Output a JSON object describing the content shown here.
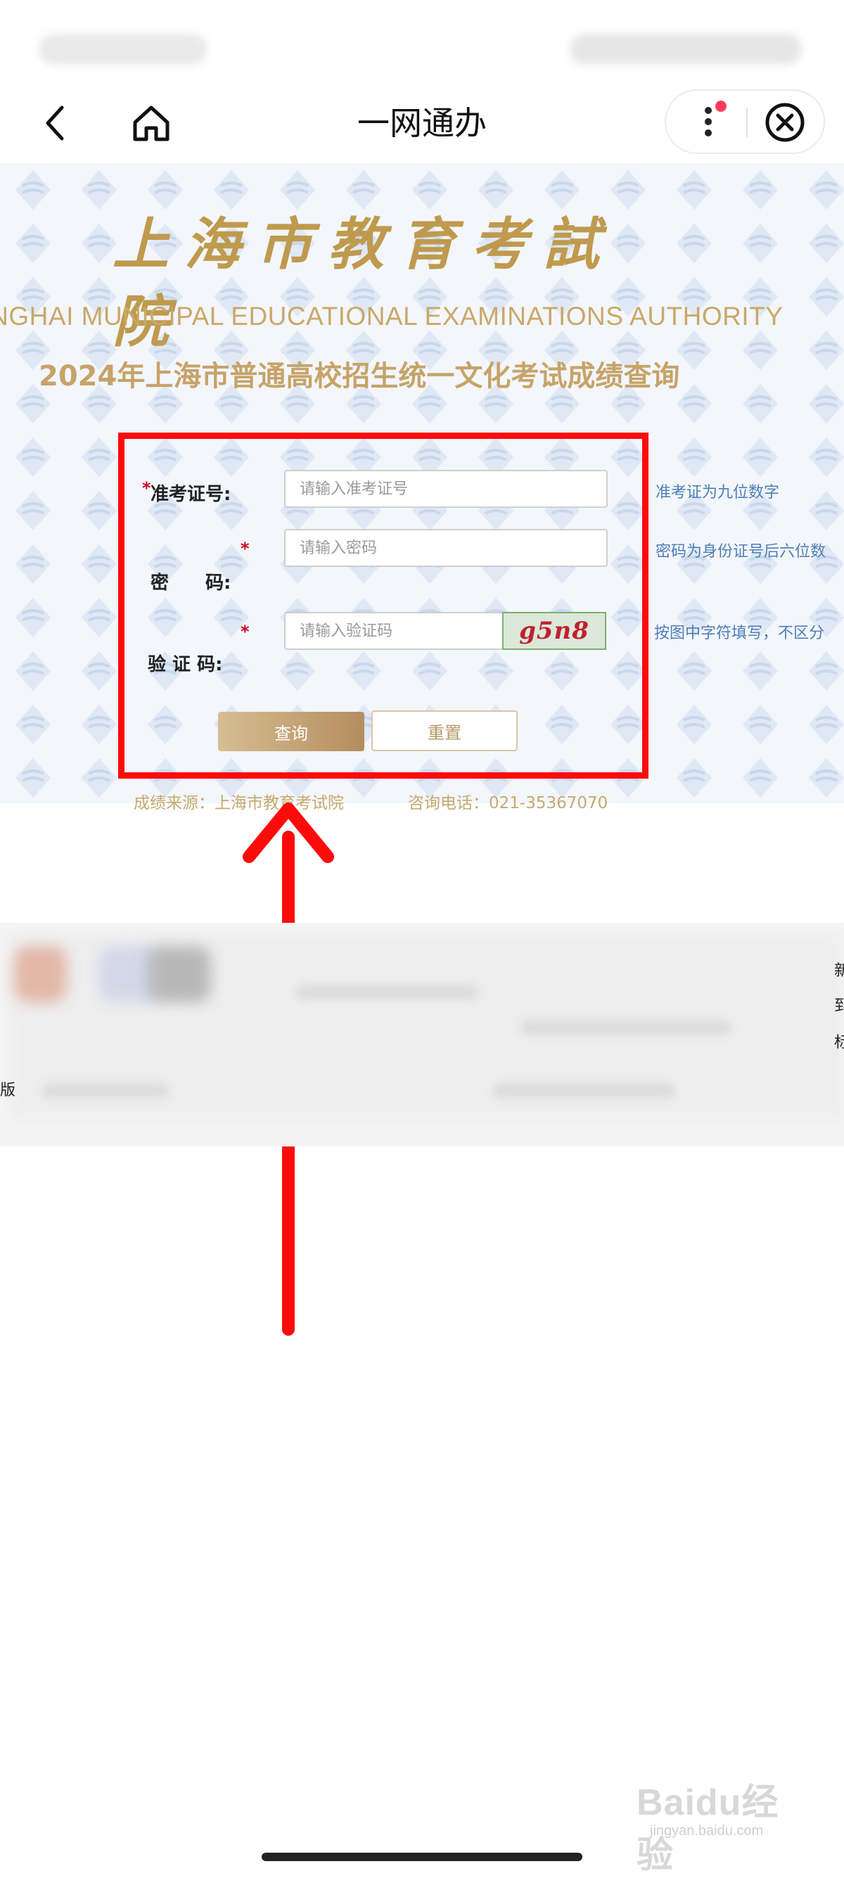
{
  "navbar": {
    "title": "一网通办",
    "back_icon": "chevron-left-icon",
    "home_icon": "home-icon",
    "more_icon": "more-vertical-icon",
    "close_icon": "close-circle-icon",
    "accent_dot_color": "#ff3b5c"
  },
  "banner": {
    "org_name_cn": "上海市教育考試院",
    "org_name_en": "ANGHAI MUNICIPAL EDUCATIONAL EXAMINATIONS AUTHORITY",
    "heading": "2024年上海市普通高校招生统一文化考试成绩查询",
    "brand_color": "#bf9a4e"
  },
  "form": {
    "required_mark": "*",
    "exam_id": {
      "label": "准考证号:",
      "placeholder": "请输入准考证号",
      "hint": "准考证为九位数字"
    },
    "password": {
      "label": "密　　码:",
      "placeholder": "请输入密码",
      "hint": "密码为身份证号后六位数"
    },
    "captcha": {
      "label": "验 证 码:",
      "placeholder": "请输入验证码",
      "image_text": "g5n8",
      "hint": "按图中字符填写，不区分"
    },
    "query_button": "查询",
    "reset_button": "重置"
  },
  "footer": {
    "source": "成绩来源：上海市教育考试院",
    "phone": "咨询电话：021-35367070"
  },
  "edge_text": {
    "left": "版",
    "right_1": "新",
    "right_2": "到",
    "right_3": "标"
  },
  "watermark": {
    "brand": "Baidu经验",
    "url": "jingyan.baidu.com"
  },
  "annotation": {
    "highlight_color": "#ff0a0a"
  }
}
